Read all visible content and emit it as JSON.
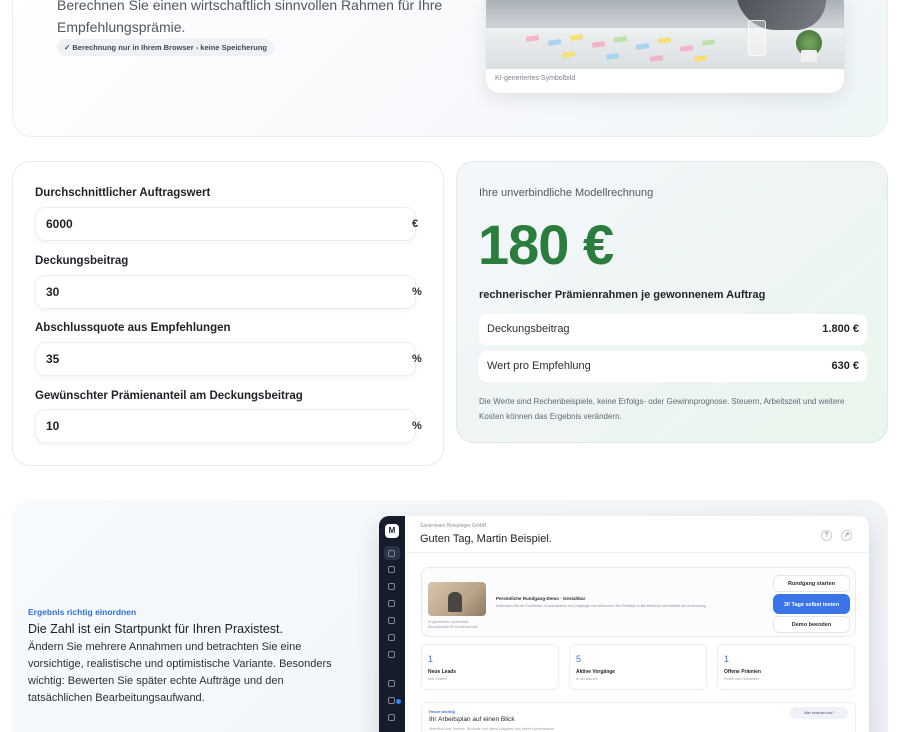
{
  "hero": {
    "text": "Berechnen Sie einen wirtschaftlich sinnvollen Rahmen für Ihre Empfehlungsprämie.",
    "badge": "✓ Berechnung nur in Ihrem Browser - keine Speicherung",
    "image_caption": "KI-generiertes Symbolbild"
  },
  "form": {
    "fields": [
      {
        "label": "Durchschnittlicher Auftragswert",
        "value": "6000",
        "unit": "€"
      },
      {
        "label": "Deckungsbeitrag",
        "value": "30",
        "unit": "%"
      },
      {
        "label": "Abschlussquote aus Empfehlungen",
        "value": "35",
        "unit": "%"
      },
      {
        "label": "Gewünschter Prämienanteil am Deckungsbeitrag",
        "value": "10",
        "unit": "%"
      }
    ]
  },
  "result": {
    "intro": "Ihre unverbindliche Modellrechnung",
    "amount": "180 €",
    "subtitle": "rechnerischer Prämienrahmen je gewonnenem Auftrag",
    "rows": [
      {
        "label": "Deckungsbeitrag",
        "value": "1.800 €"
      },
      {
        "label": "Wert pro Empfehlung",
        "value": "630 €"
      }
    ],
    "note": "Die Werte sind Rechenbeispiele, keine Erfolgs- oder Gewinnprognose. Steuern, Arbeitszeit und weitere Kosten können das Ergebnis verändern.",
    "accent_color": "#2a7d3c"
  },
  "section": {
    "eyebrow": "Ergebnis richtig einordnen",
    "title": "Die Zahl ist ein Startpunkt für Ihren Praxistest.",
    "body": "Ändern Sie mehrere Annahmen und betrachten Sie eine vorsichtige, realistische und optimistische Variante. Besonders wichtig: Bewerten Sie später echte Aufträge und den tatsächlichen Bearbeitungsaufwand."
  },
  "app_preview": {
    "logo": "M",
    "company": "Sanierteam Beispieger GmbH",
    "greeting": "Guten Tag, Martin Beispiel.",
    "header_icons": [
      "help-icon",
      "external-link-icon"
    ],
    "tour": {
      "title": "Persönliche Rundgang-Demo · Gestaltbar",
      "desc": "Entdecken Sie die Funktionen, Kundenstamm und Vorgänge und bekommen Sie Einblicke in alle Bereiche und Abläufe der Anwendung.",
      "image_caption": "KI-generiertes Symbolbild, Beispielinhalt für Kundenbereich",
      "buttons": [
        "Rundgang starten",
        "30 Tage selbst testen",
        "Demo beenden"
      ]
    },
    "stats": [
      {
        "num": "1",
        "label": "Neue Leads",
        "sub": "Seit Gestern"
      },
      {
        "num": "5",
        "label": "Aktive Vorgänge",
        "sub": "In der Bauzeit"
      },
      {
        "num": "1",
        "label": "Offene Prämien",
        "sub": "Prüfen oder auszahlen"
      }
    ],
    "plan": {
      "eyebrow": "Heute wichtig",
      "title": "Ihr Arbeitsplan auf einen Blick",
      "desc": "Überblick über Termine, Rückrufe und offene Aufgaben aus Ihrem Kundenstamm.",
      "pill": "Was bedeutet das?"
    },
    "accent_color": "#3b74e8"
  }
}
